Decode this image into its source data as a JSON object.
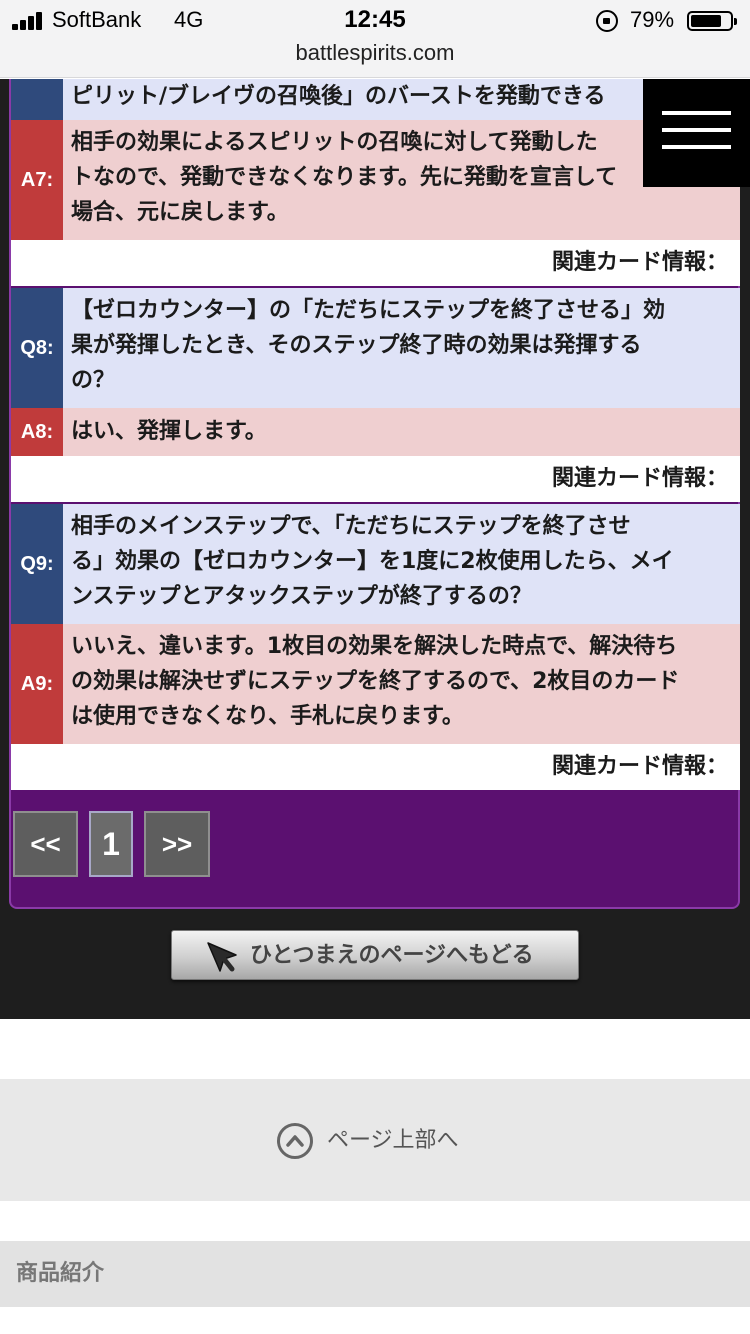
{
  "status_bar": {
    "carrier": "SoftBank",
    "network": "4G",
    "time": "12:45",
    "battery_percent": "79%",
    "battery_level": 0.79,
    "url": "battlespirits.com"
  },
  "faq": {
    "prev_question_tail": "ピリット/ブレイヴの召喚後」のバーストを発動できる",
    "items": [
      {
        "a_label": "A7:",
        "a_lines": [
          "相手の効果によるスピリットの召喚に対して発動した",
          "トなので、発動できなくなります。先に発動を宣言して",
          "場合、元に戻します。"
        ],
        "related": "関連カード情報："
      },
      {
        "q_label": "Q8:",
        "q_lines": [
          "【ゼロカウンター】の「ただちにステップを終了させる」効",
          "果が発揮したとき、そのステップ終了時の効果は発揮する",
          "の？"
        ],
        "a_label": "A8:",
        "a_lines": [
          "はい、発揮します。"
        ],
        "related": "関連カード情報："
      },
      {
        "q_label": "Q9:",
        "q_lines": [
          "相手のメインステップで、「ただちにステップを終了させ",
          "る」効果の【ゼロカウンター】を1度に2枚使用したら、メイ",
          "ンステップとアタックステップが終了するの？"
        ],
        "a_label": "A9:",
        "a_lines": [
          "いいえ、違います。1枚目の効果を解決した時点で、解決待ち",
          "の効果は解決せずにステップを終了するので、2枚目のカード",
          "は使用できなくなり、手札に戻ります。"
        ],
        "related": "関連カード情報："
      }
    ]
  },
  "pagination": {
    "prev": "<<",
    "current": "1",
    "next": ">>"
  },
  "back_button": {
    "label": "ひとつまえのページへもどる"
  },
  "page_top": {
    "label": "ページ上部へ"
  },
  "products": {
    "label": "商品紹介"
  },
  "colors": {
    "panel": "#5b1070",
    "q_label": "#2f4a7c",
    "a_label": "#c03b3b",
    "q_bg": "#dfe3f7",
    "a_bg": "#efcfd0"
  }
}
